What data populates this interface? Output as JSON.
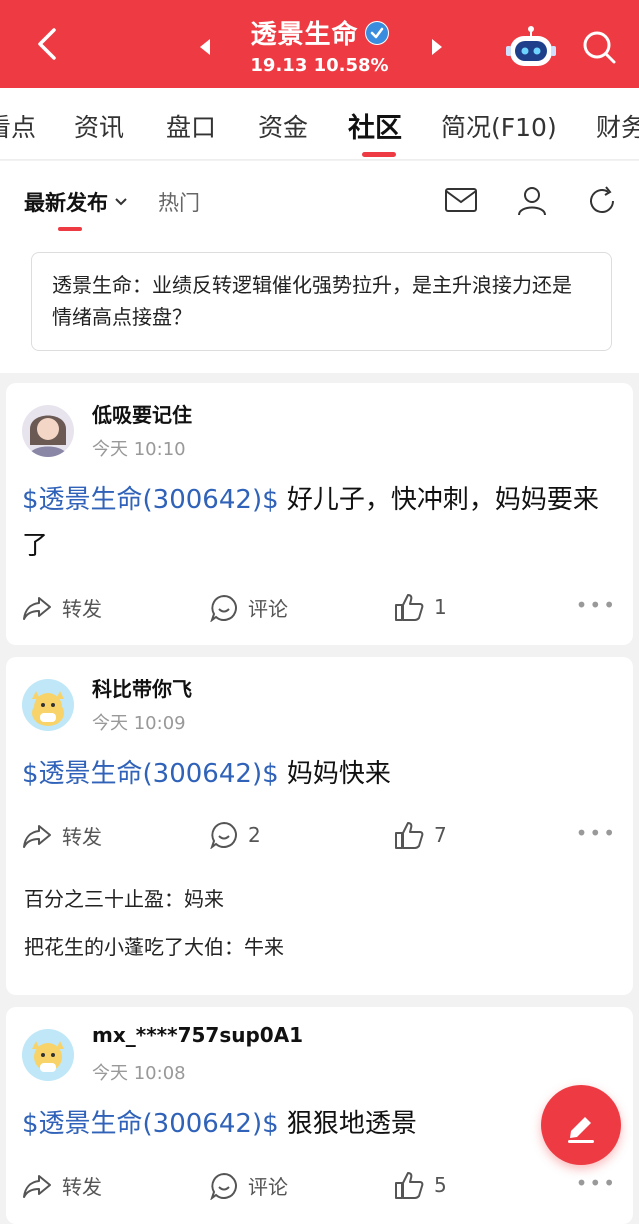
{
  "header": {
    "title": "透景生命",
    "price_line": "19.13 10.58%",
    "back_icon": "back-arrow-icon",
    "prev_icon": "prev-stock-icon",
    "next_icon": "next-stock-icon",
    "robot_icon": "robot-assistant-icon",
    "search_icon": "search-icon",
    "bg_color": "#ee3b43"
  },
  "tabs": [
    {
      "label": "看点"
    },
    {
      "label": "资讯"
    },
    {
      "label": "盘口"
    },
    {
      "label": "资金"
    },
    {
      "label": "社区"
    },
    {
      "label": "简况(F10)"
    },
    {
      "label": "财务"
    }
  ],
  "active_tab": "社区",
  "subbar": {
    "sort_label": "最新发布",
    "hot_label": "热门"
  },
  "topic": {
    "text": "透景生命：业绩反转逻辑催化强势拉升，是主升浪接力还是情绪高点接盘？"
  },
  "posts": [
    {
      "user": "低吸要记住",
      "time": "今天 10:10",
      "stock": "$透景生命(300642)$",
      "text": " 好儿子，快冲刺，妈妈要来了",
      "forward": "转发",
      "comment": "评论",
      "likes": "1",
      "more": "•••"
    },
    {
      "user": "科比带你飞",
      "time": "今天 10:09",
      "stock": "$透景生命(300642)$",
      "text": " 妈妈快来",
      "forward": "转发",
      "comment": "2",
      "likes": "7",
      "more": "•••",
      "replies": [
        "百分之三十止盈：妈来",
        "把花生的小蓬吃了大伯：牛来"
      ]
    },
    {
      "user": "mx_****757sup0A1",
      "time": "今天 10:08",
      "stock": "$透景生命(300642)$",
      "text": " 狠狠地透景",
      "forward": "转发",
      "comment": "评论",
      "likes": "5",
      "more": "•••"
    }
  ],
  "colors": {
    "accent": "#ee3b43",
    "stock_link": "#2f62b8"
  }
}
